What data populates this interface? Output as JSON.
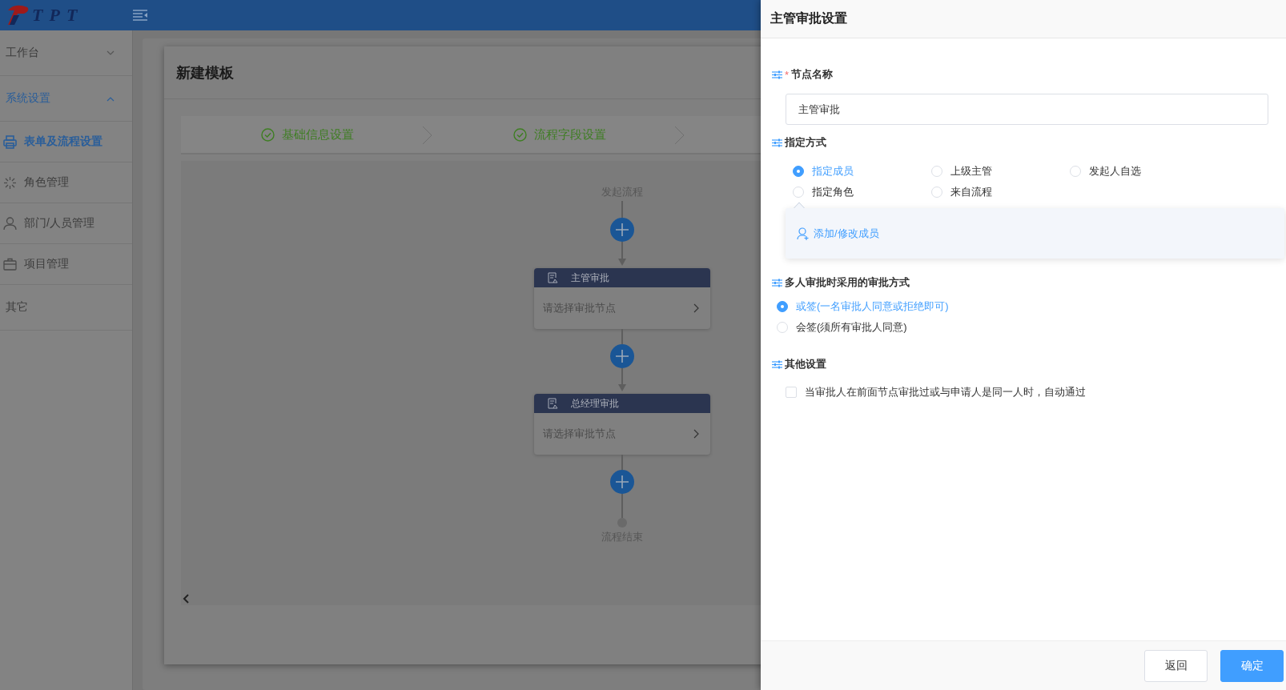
{
  "header": {
    "logo": "TPT"
  },
  "sidebar": {
    "items": [
      {
        "label": "工作台",
        "kind": "group",
        "expanded": false,
        "active": false
      },
      {
        "label": "系统设置",
        "kind": "group",
        "expanded": true,
        "active": true,
        "children": [
          {
            "label": "表单及流程设置",
            "selected": true
          },
          {
            "label": "角色管理",
            "selected": false
          },
          {
            "label": "部门/人员管理",
            "selected": false
          },
          {
            "label": "项目管理",
            "selected": false
          }
        ]
      },
      {
        "label": "其它",
        "kind": "link",
        "active": false
      }
    ]
  },
  "modal": {
    "title": "新建模板",
    "steps": [
      {
        "label": "基础信息设置",
        "done": true
      },
      {
        "label": "流程字段设置",
        "done": true
      }
    ],
    "flow": {
      "start": "发起流程",
      "nodes": [
        {
          "title": "主管审批",
          "hint": "请选择审批节点"
        },
        {
          "title": "总经理审批",
          "hint": "请选择审批节点"
        }
      ],
      "end": "流程结束"
    }
  },
  "panel": {
    "title": "主管审批设置",
    "sections": [
      {
        "kind": "text",
        "required_mark": "*",
        "label": "节点名称",
        "value": "主管审批"
      },
      {
        "kind": "radio-grid",
        "label": "指定方式",
        "options": [
          {
            "label": "指定成员",
            "selected": true
          },
          {
            "label": "上级主管",
            "selected": false
          },
          {
            "label": "发起人自选",
            "selected": false
          },
          {
            "label": "指定角色",
            "selected": false
          },
          {
            "label": "来自流程",
            "selected": false
          }
        ],
        "popover": {
          "action": "添加/修改成员"
        }
      },
      {
        "kind": "radio-list",
        "label": "多人审批时采用的审批方式",
        "options": [
          {
            "label": "或签(一名审批人同意或拒绝即可)",
            "selected": true
          },
          {
            "label": "会签(须所有审批人同意)",
            "selected": false
          }
        ]
      },
      {
        "kind": "checkbox",
        "label": "其他设置",
        "options": [
          {
            "label": "当审批人在前面节点审批过或与申请人是同一人时，自动通过",
            "checked": false
          }
        ]
      }
    ],
    "buttons": [
      {
        "label": "返回",
        "kind": "default"
      },
      {
        "label": "确定",
        "kind": "primary"
      }
    ]
  }
}
